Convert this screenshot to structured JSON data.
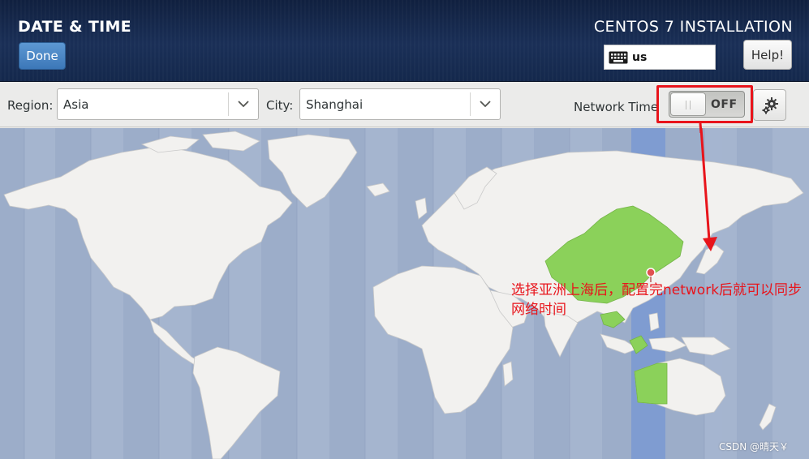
{
  "header": {
    "title": "DATE & TIME",
    "done_label": "Done",
    "install_title": "CENTOS 7 INSTALLATION",
    "keyboard_layout": "us",
    "help_label": "Help!"
  },
  "toolbar": {
    "region_label": "Region:",
    "region_value": "Asia",
    "city_label": "City:",
    "city_value": "Shanghai",
    "network_time_label": "Network Time",
    "network_time_state": "OFF"
  },
  "icons": {
    "keyboard": "keyboard-icon",
    "dropdown": "chevron-down-icon",
    "settings": "gear-icon",
    "location": "map-pin-icon"
  },
  "colors": {
    "header_bg": "#14284c",
    "done_button": "#4a86c5",
    "map_ocean": "#9dafcb",
    "map_land": "#f1f0ee",
    "selected_timezone_land": "#8bd15a",
    "selected_timezone_band": "#7e9bd0",
    "annotation_red": "#e8141b"
  },
  "annotation": {
    "text": "选择亚洲上海后，配置完network后就可以同步网络时间"
  },
  "watermark": "CSDN @晴天￥"
}
